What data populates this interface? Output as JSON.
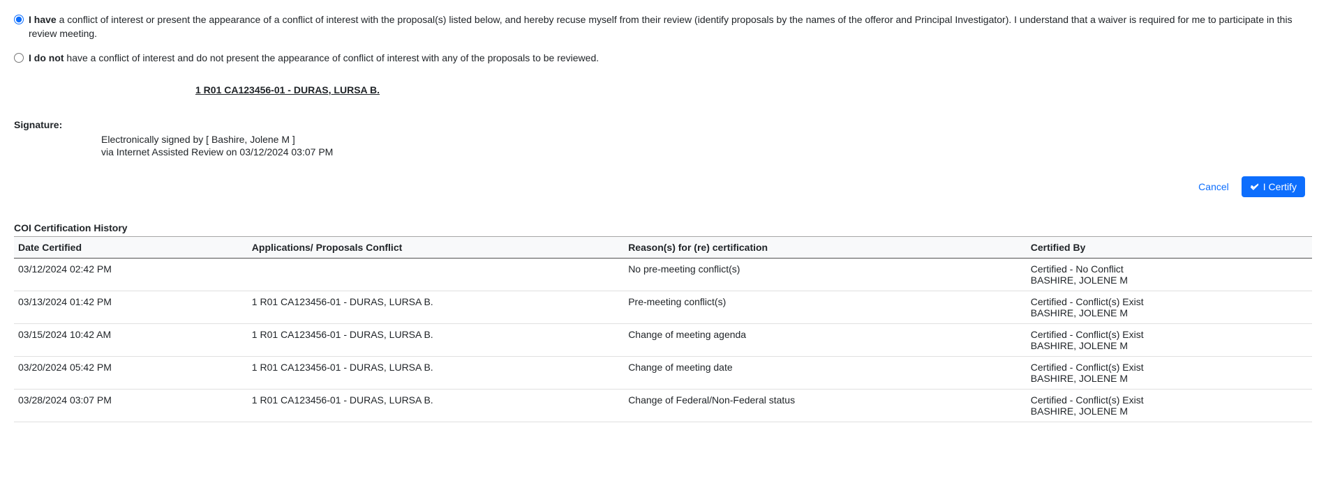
{
  "radios": {
    "have": {
      "bold": "I have",
      "text": " a conflict of interest or present the appearance of a conflict of interest with the proposal(s) listed below, and hereby recuse myself from their review (identify proposals by the names of the offeror and Principal Investigator). I understand that a waiver is required for me to participate in this review meeting."
    },
    "not": {
      "bold": "I do not",
      "text": " have a conflict of interest and do not present the appearance of conflict of interest with any of the proposals to be reviewed."
    }
  },
  "proposal_link": "1 R01 CA123456-01 - DURAS, LURSA B.",
  "signature": {
    "label": "Signature:",
    "line1": "Electronically signed by [ Bashire, Jolene M ]",
    "line2": "via Internet Assisted Review on 03/12/2024 03:07 PM"
  },
  "actions": {
    "cancel": "Cancel",
    "certify": "I Certify"
  },
  "history": {
    "title": "COI Certification History",
    "headers": {
      "date": "Date Certified",
      "apps": "Applications/ Proposals Conflict",
      "reason": "Reason(s) for (re) certification",
      "by": "Certified By"
    },
    "rows": [
      {
        "date": "03/12/2024 02:42 PM",
        "apps": "",
        "reason": "No pre-meeting conflict(s)",
        "by1": "Certified - No Conflict",
        "by2": "BASHIRE, JOLENE M"
      },
      {
        "date": "03/13/2024 01:42 PM",
        "apps": "1 R01 CA123456-01 - DURAS, LURSA B.",
        "reason": "Pre-meeting conflict(s)",
        "by1": "Certified - Conflict(s) Exist",
        "by2": "BASHIRE, JOLENE M"
      },
      {
        "date": "03/15/2024 10:42 AM",
        "apps": "1 R01 CA123456-01 - DURAS, LURSA B.",
        "reason": "Change of meeting agenda",
        "by1": "Certified - Conflict(s) Exist",
        "by2": "BASHIRE, JOLENE M"
      },
      {
        "date": "03/20/2024 05:42 PM",
        "apps": "1 R01 CA123456-01 - DURAS, LURSA B.",
        "reason": "Change of meeting date",
        "by1": "Certified - Conflict(s) Exist",
        "by2": "BASHIRE, JOLENE M"
      },
      {
        "date": "03/28/2024 03:07 PM",
        "apps": "1 R01 CA123456-01 - DURAS, LURSA B.",
        "reason": "Change of Federal/Non-Federal status",
        "by1": "Certified - Conflict(s) Exist",
        "by2": "BASHIRE, JOLENE M"
      }
    ]
  }
}
